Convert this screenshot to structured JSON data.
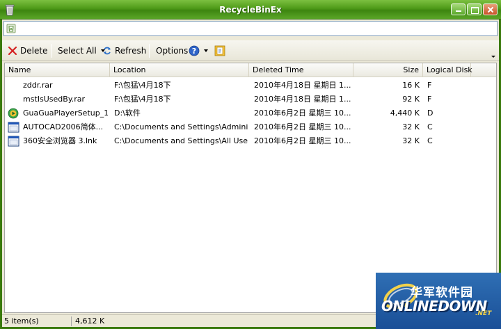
{
  "window": {
    "title": "RecycleBinEx"
  },
  "toolbar": {
    "delete_label": "Delete",
    "select_all_label": "Select All",
    "refresh_label": "Refresh",
    "options_label": "Options"
  },
  "columns": [
    {
      "label": "Name"
    },
    {
      "label": "Location"
    },
    {
      "label": "Deleted Time"
    },
    {
      "label": "Size"
    },
    {
      "label": "Logical Disk"
    }
  ],
  "rows": [
    {
      "name": "zddr.rar",
      "location": "F:\\包猛\\4月18下",
      "deleted": "2010年4月18日 星期日 1...",
      "size": "16 K",
      "disk": "F",
      "icon": "none"
    },
    {
      "name": "mstIsUsedBy.rar",
      "location": "F:\\包猛\\4月18下",
      "deleted": "2010年4月18日 星期日 1...",
      "size": "92 K",
      "disk": "F",
      "icon": "none"
    },
    {
      "name": "GuaGuaPlayerSetup_1...",
      "location": "D:\\软件",
      "deleted": "2010年6月2日 星期三 10...",
      "size": "4,440 K",
      "disk": "D",
      "icon": "player-setup-icon"
    },
    {
      "name": "AUTOCAD2006简体...",
      "location": "C:\\Documents and Settings\\Administ...",
      "deleted": "2010年6月2日 星期三 10...",
      "size": "32 K",
      "disk": "C",
      "icon": "shortcut-icon"
    },
    {
      "name": "360安全浏览器 3.lnk",
      "location": "C:\\Documents and Settings\\All Users...",
      "deleted": "2010年6月2日 星期三 10...",
      "size": "32 K",
      "disk": "C",
      "icon": "shortcut-icon"
    }
  ],
  "status": {
    "items": "5 item(s)",
    "size": "4,612 K"
  },
  "watermark": {
    "cn": "华军软件园",
    "en": "ONLINEDOWN",
    "suffix": ".NET"
  },
  "colors": {
    "title_green": "#4e9a18",
    "chrome": "#ece9d8",
    "watermark_blue": "#1f5aa3"
  }
}
